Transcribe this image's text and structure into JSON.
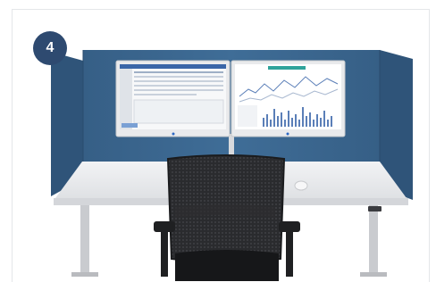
{
  "step_badge": {
    "label": "4"
  },
  "colors": {
    "panel_blue": "#3d6a93",
    "badge_blue": "#2e4a70",
    "desk_top": "#ebecee",
    "chair_black": "#1f2022"
  },
  "scene": {
    "subject": "office-desk-with-privacy-screen",
    "monitor_count": 2
  }
}
